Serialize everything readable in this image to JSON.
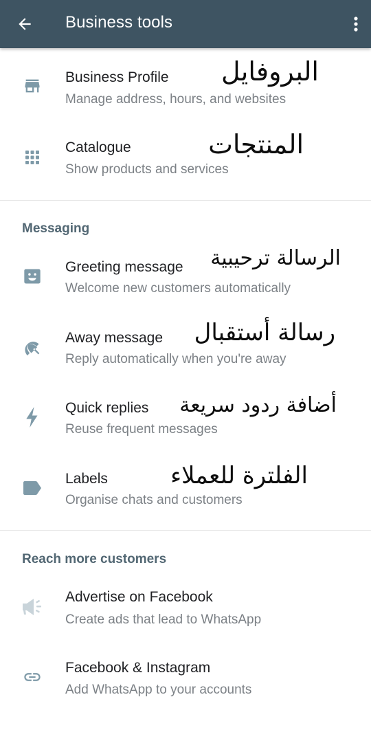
{
  "appbar": {
    "title": "Business tools"
  },
  "items": {
    "profile": {
      "title": "Business Profile",
      "subtitle": "Manage address, hours, and websites",
      "note": "البروفايل"
    },
    "catalogue": {
      "title": "Catalogue",
      "subtitle": "Show products and services",
      "note": "المنتجات"
    },
    "greeting": {
      "title": "Greeting message",
      "subtitle": "Welcome new customers automatically",
      "note": "الرسالة ترحيبية"
    },
    "away": {
      "title": "Away message",
      "subtitle": "Reply automatically when you're away",
      "note": "رسالة أستقبال"
    },
    "quick": {
      "title": "Quick replies",
      "subtitle": "Reuse frequent messages",
      "note": "أضافة ردود سريعة"
    },
    "labels": {
      "title": "Labels",
      "subtitle": "Organise chats and customers",
      "note": "الفلترة للعملاء"
    },
    "facebook": {
      "title": "Advertise on Facebook",
      "subtitle": "Create ads that lead to WhatsApp"
    },
    "fbig": {
      "title": "Facebook & Instagram",
      "subtitle": "Add WhatsApp to your accounts"
    }
  },
  "sections": {
    "messaging": "Messaging",
    "reach": "Reach more customers"
  },
  "icons": {
    "back": "arrow-left-icon",
    "more": "more-vert-icon",
    "profile": "store-icon",
    "catalogue": "grid-icon",
    "greeting": "smiley-message-icon",
    "away": "away-icon",
    "quick": "bolt-icon",
    "labels": "label-icon",
    "facebook": "megaphone-icon",
    "fbig": "link-icon"
  },
  "colors": {
    "appbar": "#3e5462",
    "icon": "#7e9aa8",
    "section": "#526773"
  }
}
